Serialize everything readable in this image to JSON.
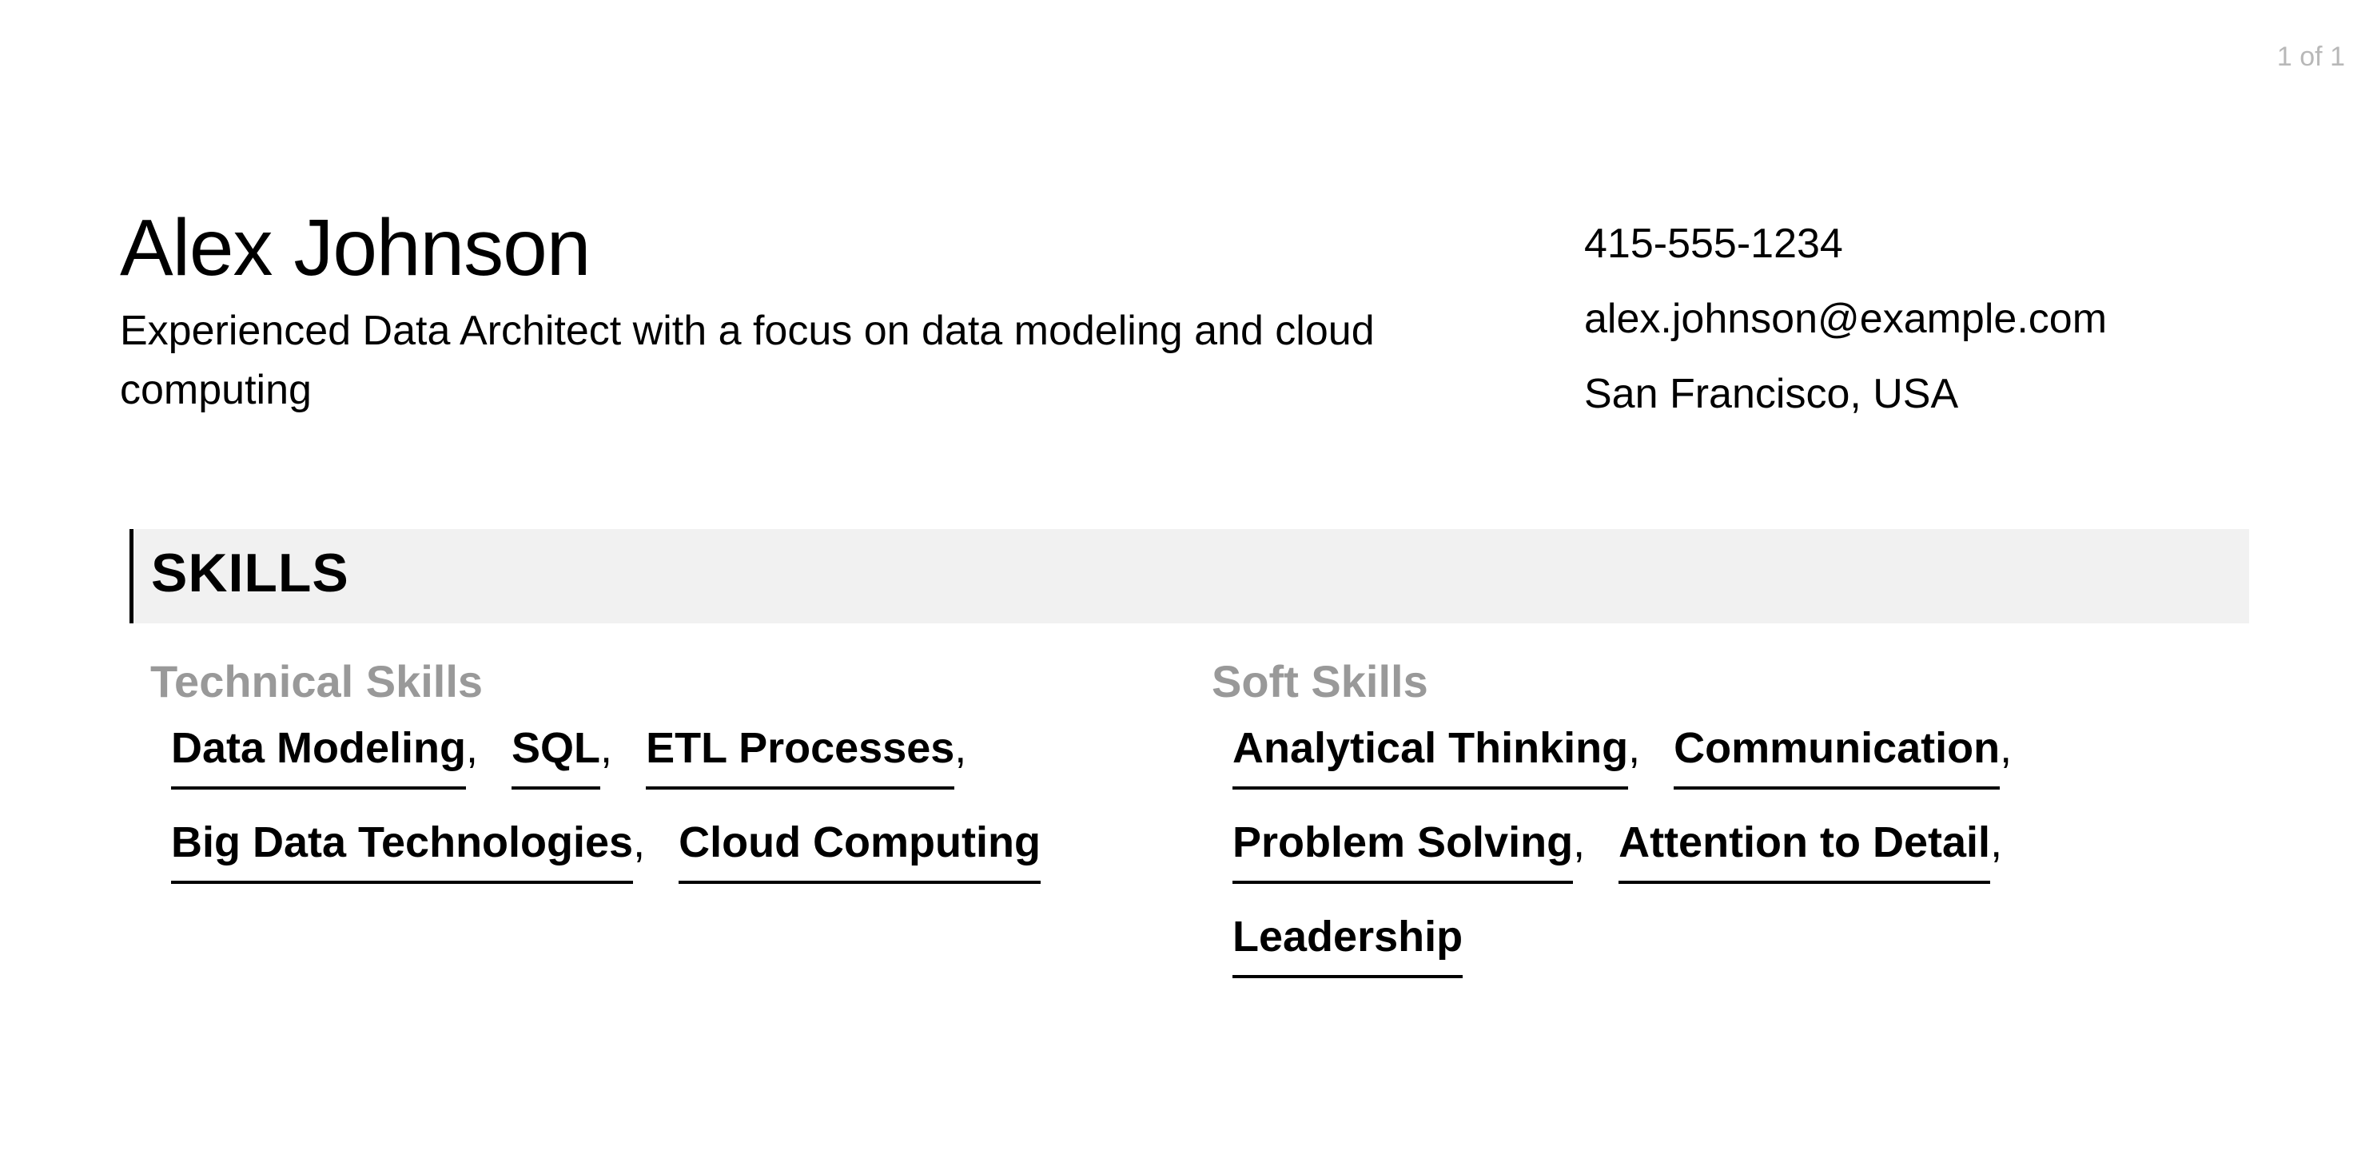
{
  "page_indicator": "1 of 1",
  "header": {
    "name": "Alex Johnson",
    "summary": "Experienced Data Architect with a focus on data modeling and cloud computing"
  },
  "contact": {
    "phone": "415-555-1234",
    "email": "alex.johnson@example.com",
    "location": "San Francisco, USA"
  },
  "skills": {
    "title": "SKILLS",
    "technical": {
      "title": "Technical Skills",
      "items": [
        "Data Modeling",
        "SQL",
        "ETL Processes",
        "Big Data Technologies",
        "Cloud Computing"
      ]
    },
    "soft": {
      "title": "Soft Skills",
      "items": [
        "Analytical Thinking",
        "Communication",
        "Problem Solving",
        "Attention to Detail",
        "Leadership"
      ]
    }
  },
  "colors": {
    "subheading": "#999999",
    "band": "#f1f1f1",
    "page_indicator": "#b8b8b8"
  }
}
